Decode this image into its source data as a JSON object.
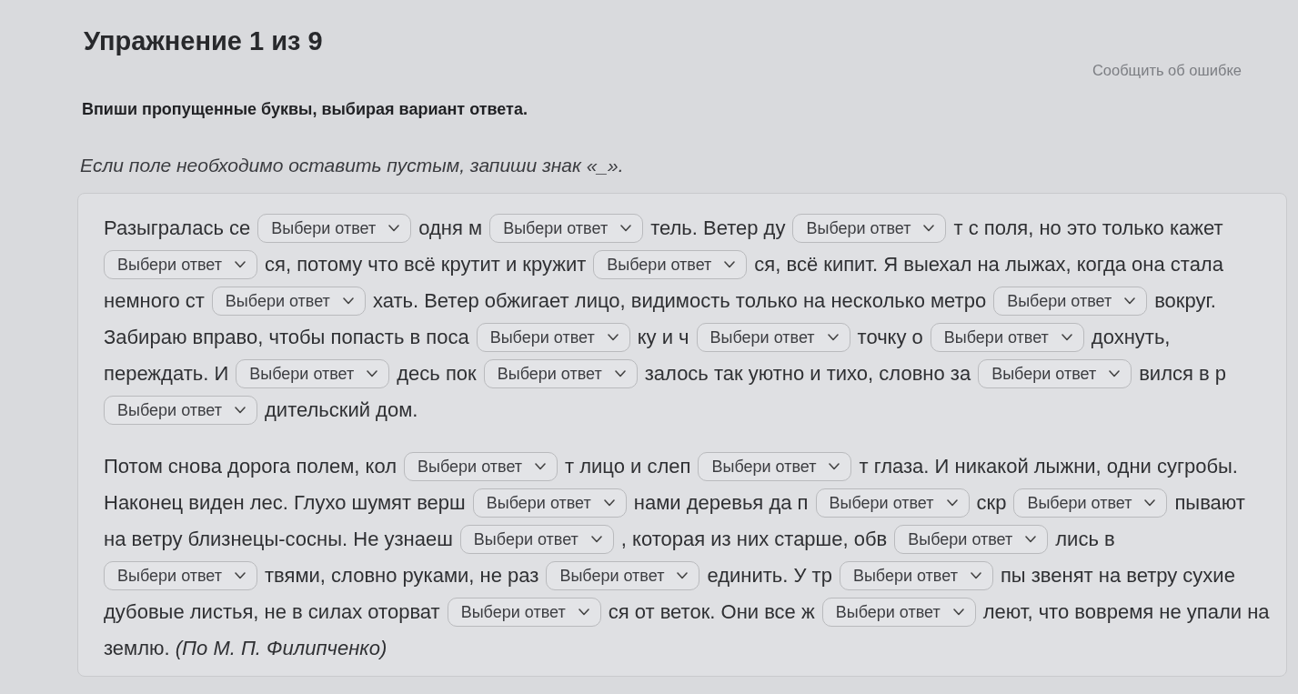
{
  "exercise": {
    "title": "Упражнение 1 из 9",
    "report_link": "Сообщить об ошибке",
    "instruction": "Впиши пропущенные буквы, выбирая вариант ответа.",
    "hint": "Если поле необходимо оставить пустым, запиши знак «_»."
  },
  "text_panel": {
    "paragraphs": [
      {
        "lines": [
          [
            {
              "kind": "text",
              "text": "Разыгралась се"
            },
            {
              "kind": "select",
              "placeholder": "Выбери ответ"
            },
            {
              "kind": "text",
              "text": "одня м"
            },
            {
              "kind": "select",
              "placeholder": "Выбери ответ"
            },
            {
              "kind": "text",
              "text": "тель. Ветер ду"
            },
            {
              "kind": "select",
              "placeholder": "Выбери ответ"
            },
            {
              "kind": "text",
              "text": "т с поля, но это только кажет"
            }
          ],
          [
            {
              "kind": "select",
              "placeholder": "Выбери ответ"
            },
            {
              "kind": "text",
              "text": "ся, потому что всё крутит и кружит"
            },
            {
              "kind": "select",
              "placeholder": "Выбери ответ"
            },
            {
              "kind": "text",
              "text": "ся, всё кипит. Я выехал на лыжах, когда она стала"
            }
          ],
          [
            {
              "kind": "text",
              "text": "немного ст"
            },
            {
              "kind": "select",
              "placeholder": "Выбери ответ"
            },
            {
              "kind": "text",
              "text": "хать. Ветер обжигает лицо, видимость только на несколько метро"
            },
            {
              "kind": "select",
              "placeholder": "Выбери ответ"
            },
            {
              "kind": "text",
              "text": "вокруг."
            }
          ],
          [
            {
              "kind": "text",
              "text": "Забираю вправо, чтобы попасть в поса"
            },
            {
              "kind": "select",
              "placeholder": "Выбери ответ"
            },
            {
              "kind": "text",
              "text": "ку и ч"
            },
            {
              "kind": "select",
              "placeholder": "Выбери ответ"
            },
            {
              "kind": "text",
              "text": "точку о"
            },
            {
              "kind": "select",
              "placeholder": "Выбери ответ"
            },
            {
              "kind": "text",
              "text": "дохнуть,"
            }
          ],
          [
            {
              "kind": "text",
              "text": "переждать. И"
            },
            {
              "kind": "select",
              "placeholder": "Выбери ответ"
            },
            {
              "kind": "text",
              "text": "десь пок"
            },
            {
              "kind": "select",
              "placeholder": "Выбери ответ"
            },
            {
              "kind": "text",
              "text": "залось так уютно и тихо, словно за"
            },
            {
              "kind": "select",
              "placeholder": "Выбери ответ"
            },
            {
              "kind": "text",
              "text": "вился в р"
            }
          ],
          [
            {
              "kind": "select",
              "placeholder": "Выбери ответ"
            },
            {
              "kind": "text",
              "text": "дительский дом."
            }
          ]
        ]
      },
      {
        "lines": [
          [
            {
              "kind": "text",
              "text": "Потом снова дорога полем, кол"
            },
            {
              "kind": "select",
              "placeholder": "Выбери ответ"
            },
            {
              "kind": "text",
              "text": "т лицо и слеп"
            },
            {
              "kind": "select",
              "placeholder": "Выбери ответ"
            },
            {
              "kind": "text",
              "text": "т глаза. И никакой лыжни, одни сугробы."
            }
          ],
          [
            {
              "kind": "text",
              "text": "Наконец виден лес. Глухо шумят верш"
            },
            {
              "kind": "select",
              "placeholder": "Выбери ответ"
            },
            {
              "kind": "text",
              "text": "нами деревья да п"
            },
            {
              "kind": "select",
              "placeholder": "Выбери ответ"
            },
            {
              "kind": "text",
              "text": "скр"
            },
            {
              "kind": "select",
              "placeholder": "Выбери ответ"
            },
            {
              "kind": "text",
              "text": "пывают"
            }
          ],
          [
            {
              "kind": "text",
              "text": "на ветру близнецы-сосны. Не узнаеш"
            },
            {
              "kind": "select",
              "placeholder": "Выбери ответ"
            },
            {
              "kind": "text",
              "text": ", которая из них старше, обв"
            },
            {
              "kind": "select",
              "placeholder": "Выбери ответ"
            },
            {
              "kind": "text",
              "text": "лись в"
            }
          ],
          [
            {
              "kind": "select",
              "placeholder": "Выбери ответ"
            },
            {
              "kind": "text",
              "text": "твями, словно руками, не раз"
            },
            {
              "kind": "select",
              "placeholder": "Выбери ответ"
            },
            {
              "kind": "text",
              "text": "единить. У тр"
            },
            {
              "kind": "select",
              "placeholder": "Выбери ответ"
            },
            {
              "kind": "text",
              "text": "пы звенят на ветру сухие"
            }
          ],
          [
            {
              "kind": "text",
              "text": "дубовые листья, не в силах оторват"
            },
            {
              "kind": "select",
              "placeholder": "Выбери ответ"
            },
            {
              "kind": "text",
              "text": "ся от веток. Они все ж"
            },
            {
              "kind": "select",
              "placeholder": "Выбери ответ"
            },
            {
              "kind": "text",
              "text": "леют, что вовремя не упали на"
            }
          ],
          [
            {
              "kind": "text",
              "text": "землю. *(По М. П. Филипченко)*"
            }
          ]
        ]
      }
    ]
  }
}
